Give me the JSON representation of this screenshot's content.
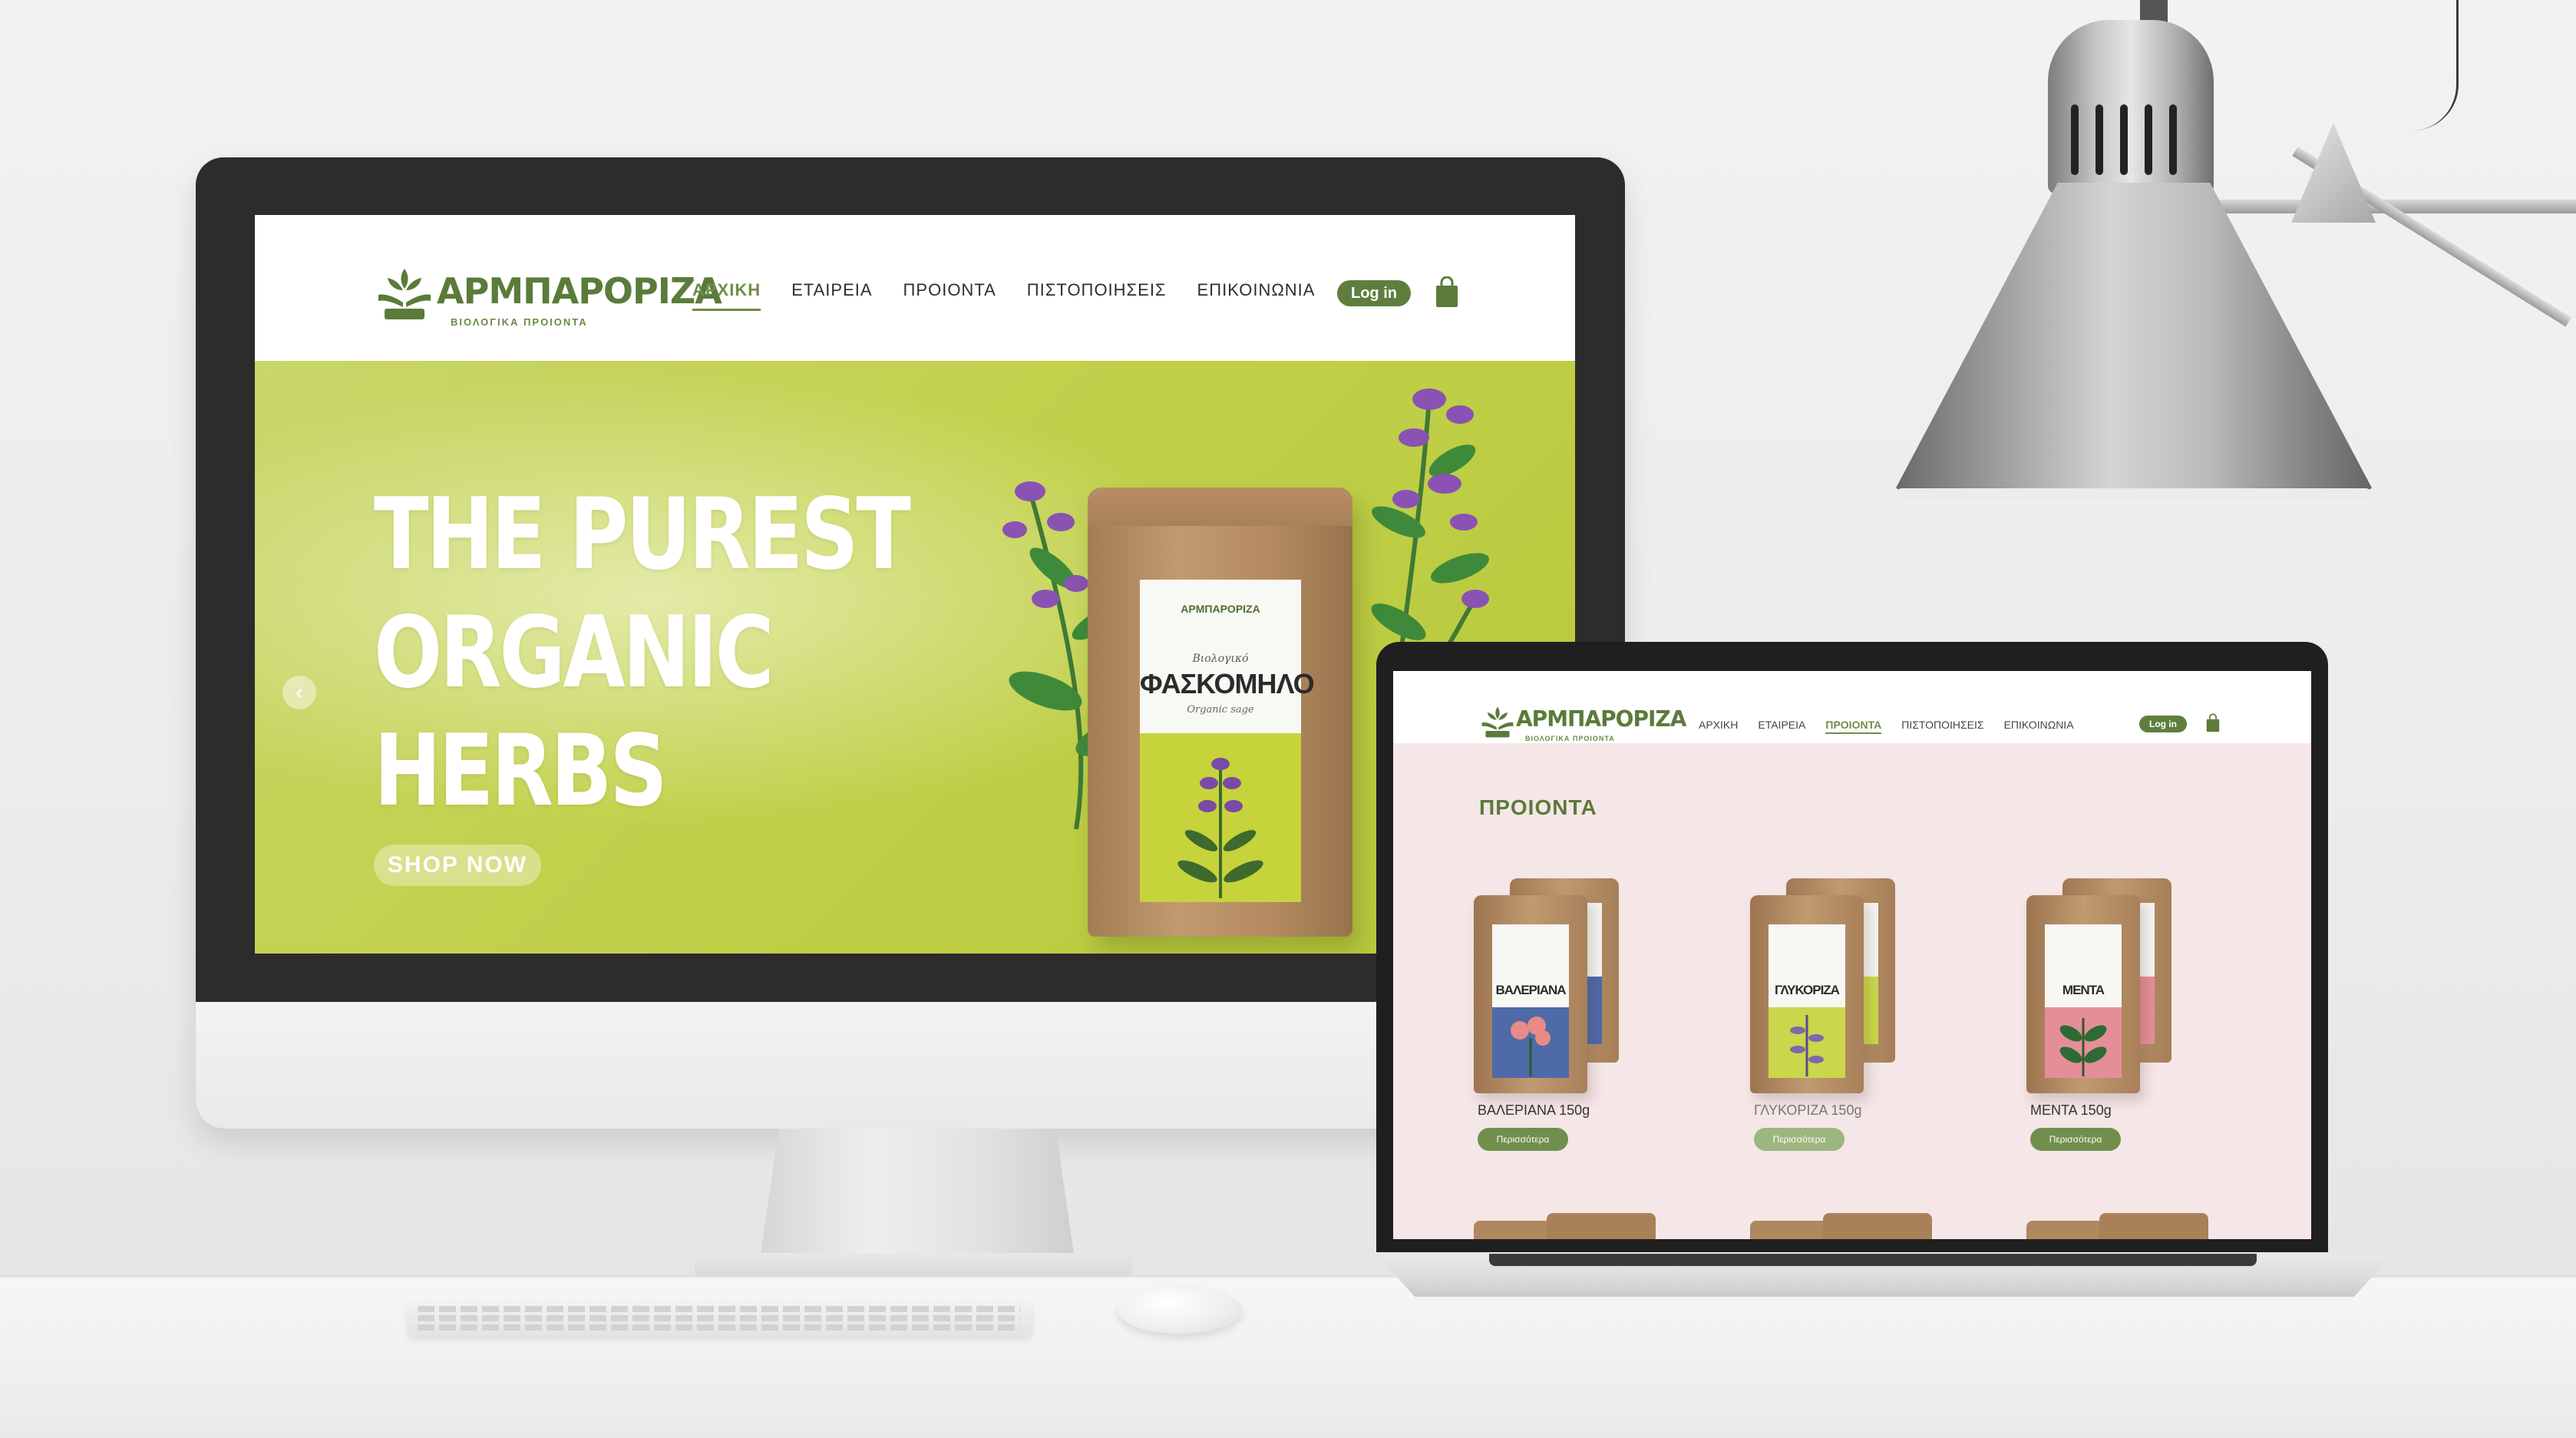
{
  "desktop": {
    "brand": {
      "name": "ΑΡΜΠΑΡΟΡΙΖΑ",
      "tagline": "ΒΙΟΛΟΓΙΚΑ ΠΡΟΙΟΝΤΑ"
    },
    "nav": {
      "items": [
        {
          "label": "ΑΡΧΙΚΗ",
          "active": true
        },
        {
          "label": "ΕΤΑΙΡΕΙΑ",
          "active": false
        },
        {
          "label": "ΠΡΟΙΟΝΤΑ",
          "active": false
        },
        {
          "label": "ΠΙΣΤΟΠΟΙΗΣΕΙΣ",
          "active": false
        },
        {
          "label": "ΕΠΙΚΟΙΝΩΝΙΑ",
          "active": false
        }
      ],
      "login_label": "Log in"
    },
    "hero": {
      "title_lines": [
        "THE PUREST",
        "ORGANIC",
        "HERBS"
      ],
      "cta_label": "SHOP NOW",
      "prev_arrow": "‹",
      "package": {
        "sub": "Βιολογικό",
        "name": "ΦΑΣΚΟΜΗΛΟ",
        "en": "Organic sage"
      }
    },
    "colors": {
      "brand_green": "#5b7b3a",
      "hero_bg": "#c2d14d"
    }
  },
  "laptop": {
    "brand": {
      "name": "ΑΡΜΠΑΡΟΡΙΖΑ",
      "tagline": "ΒΙΟΛΟΓΙΚΑ ΠΡΟΙΟΝΤΑ"
    },
    "nav": {
      "items": [
        {
          "label": "ΑΡΧΙΚΗ",
          "active": false
        },
        {
          "label": "ΕΤΑΙΡΕΙΑ",
          "active": false
        },
        {
          "label": "ΠΡΟΙΟΝΤΑ",
          "active": true
        },
        {
          "label": "ΠΙΣΤΟΠΟΙΗΣΕΙΣ",
          "active": false
        },
        {
          "label": "ΕΠΙΚΟΙΝΩΝΙΑ",
          "active": false
        }
      ],
      "login_label": "Log in"
    },
    "page_title": "ΠΡΟΙΟΝΤΑ",
    "products": [
      {
        "name": "ΒΑΛΕΡΙΑΝΑ 150g",
        "pack_name": "ΒΑΛΕΡΙΑΝΑ",
        "more_label": "Περισσότερα",
        "label_color": "#4f6aa8",
        "faded": false
      },
      {
        "name": "ΓΛΥΚΟΡΙΖΑ 150g",
        "pack_name": "ΓΛΥΚΟΡΙΖΑ",
        "more_label": "Περισσότερα",
        "label_color": "#cbd64a",
        "faded": true
      },
      {
        "name": "ΜΕΝΤΑ 150g",
        "pack_name": "ΜΕΝΤΑ",
        "more_label": "Περισσότερα",
        "label_color": "#e48f97",
        "faded": false
      }
    ],
    "colors": {
      "page_bg": "#f5e6e7"
    }
  }
}
